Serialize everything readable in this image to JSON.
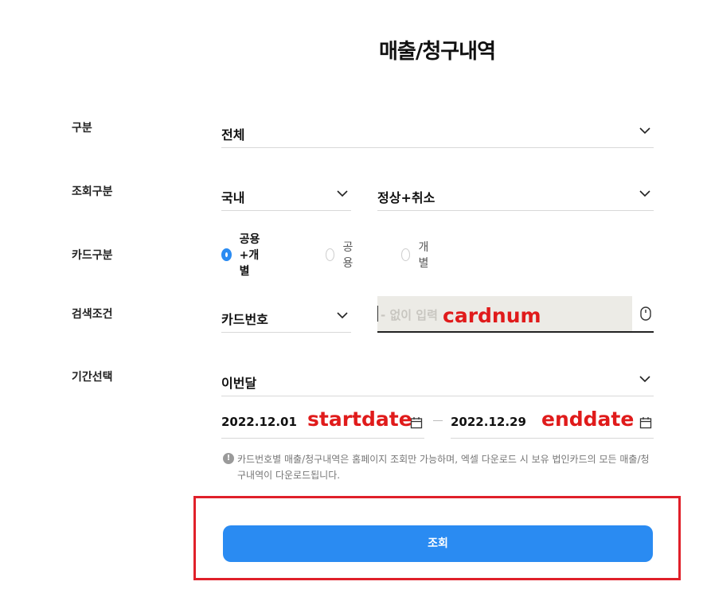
{
  "page": {
    "title": "매출/청구내역"
  },
  "form": {
    "division": {
      "label": "구분",
      "value": "전체"
    },
    "inquiry": {
      "label": "조회구분",
      "region": "국내",
      "status": "정상+취소"
    },
    "card_type": {
      "label": "카드구분",
      "options": [
        "공용+개별",
        "공용",
        "개별"
      ],
      "selected": "공용+개별"
    },
    "search": {
      "label": "검색조건",
      "type": "카드번호",
      "placeholder": "- 없이 입력",
      "annotation": "cardnum"
    },
    "period": {
      "label": "기간선택",
      "value": "이번달",
      "start_date": "2022.12.01",
      "start_annotation": "startdate",
      "end_date": "2022.12.29",
      "end_annotation": "enddate"
    },
    "notice": "카드번호별 매출/청구내역은 홈페이지 조회만 가능하며, 엑셀 다운로드 시 보유 법인카드의 모든 매출/청구내역이 다운로드됩니다.",
    "submit_label": "조회"
  },
  "icons": {
    "chevron": "chevron-down-icon",
    "calendar": "calendar-icon",
    "mouse": "mouse-icon",
    "info": "info-icon"
  },
  "colors": {
    "accent": "#2a8bf2",
    "annotation_red": "#e01b1b",
    "highlight_box": "#e0202a"
  }
}
